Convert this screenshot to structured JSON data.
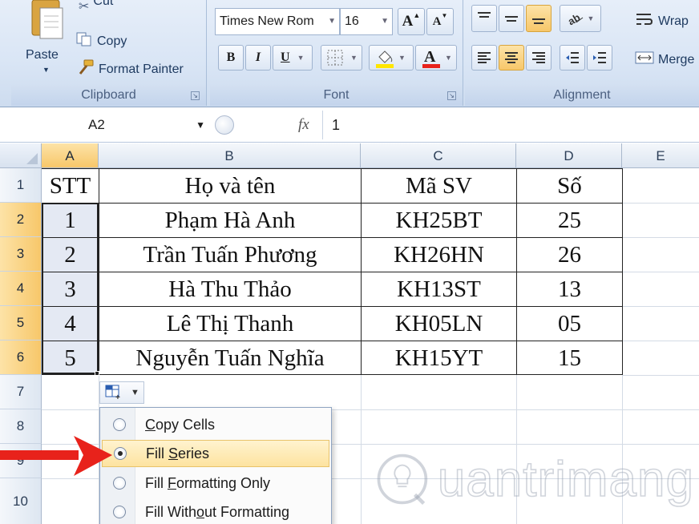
{
  "ribbon": {
    "clipboard": {
      "paste_label": "Paste",
      "cut_label": "Cut",
      "copy_label": "Copy",
      "format_painter_label": "Format Painter",
      "group_label": "Clipboard"
    },
    "font": {
      "font_name": "Times New Rom",
      "font_size": "16",
      "group_label": "Font"
    },
    "alignment": {
      "wrap_label": "Wrap",
      "merge_label": "Merge",
      "group_label": "Alignment"
    }
  },
  "formula_bar": {
    "name_box": "A2",
    "fx_label": "fx",
    "value": "1"
  },
  "columns": [
    "A",
    "B",
    "C",
    "D",
    "E"
  ],
  "rows": [
    "1",
    "2",
    "3",
    "4",
    "5",
    "6",
    "7",
    "8",
    "9",
    "10"
  ],
  "table": {
    "header": [
      "STT",
      "Họ và tên",
      "Mã SV",
      "Số"
    ],
    "rows": [
      [
        "1",
        "Phạm Hà Anh",
        "KH25BT",
        "25"
      ],
      [
        "2",
        "Trần Tuấn Phương",
        "KH26HN",
        "26"
      ],
      [
        "3",
        "Hà Thu Thảo",
        "KH13ST",
        "13"
      ],
      [
        "4",
        "Lê Thị Thanh",
        "KH05LN",
        "05"
      ],
      [
        "5",
        "Nguyễn Tuấn Nghĩa",
        "KH15YT",
        "15"
      ]
    ]
  },
  "autofill_menu": {
    "items": [
      {
        "pre": "",
        "key": "C",
        "post": "opy Cells",
        "selected": false
      },
      {
        "pre": "Fill ",
        "key": "S",
        "post": "eries",
        "selected": true
      },
      {
        "pre": "Fill ",
        "key": "F",
        "post": "ormatting Only",
        "selected": false
      },
      {
        "pre": "Fill With",
        "key": "o",
        "post": "ut Formatting",
        "selected": false
      }
    ]
  },
  "watermark": {
    "text": "uantrimang"
  },
  "colors": {
    "highlight_header": "#f7c76a",
    "arrow": "#e8221b",
    "font_color_bar": "#e8221b",
    "fill_color_bar": "#ffe600"
  }
}
